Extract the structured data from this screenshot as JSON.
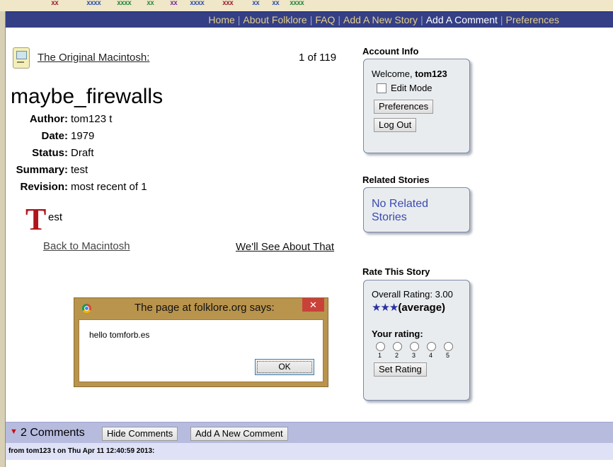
{
  "nav": {
    "items": [
      "Home",
      "About Folklore",
      "FAQ",
      "Add A New Story",
      "Add A Comment",
      "Preferences"
    ],
    "current_index": 4
  },
  "story": {
    "folder_link": "The Original Macintosh:",
    "count": "1 of 119",
    "title": "maybe_firewalls",
    "meta": [
      {
        "label": "Author:",
        "value": "tom123 t"
      },
      {
        "label": "Date:",
        "value": "1979"
      },
      {
        "label": "Status:",
        "value": "Draft"
      },
      {
        "label": "Summary:",
        "value": "test"
      },
      {
        "label": "Revision:",
        "value": "most recent of 1"
      }
    ],
    "body_dropcap": "T",
    "body_rest": "est",
    "back_link": "Back to Macintosh",
    "next_link": "We'll See About That"
  },
  "account": {
    "heading": "Account Info",
    "welcome": "Welcome,",
    "user": "tom123",
    "edit_mode": "Edit Mode",
    "preferences_btn": "Preferences",
    "logout_btn": "Log Out"
  },
  "related": {
    "heading": "Related Stories",
    "text": "No Related Stories"
  },
  "rating": {
    "heading": "Rate This Story",
    "overall": "Overall Rating: 3.00",
    "stars": "★★★",
    "star_count": 3,
    "average_label": "(average)",
    "your_rating": "Your rating:",
    "options": [
      "1",
      "2",
      "3",
      "4",
      "5"
    ],
    "set_btn": "Set Rating"
  },
  "dialog": {
    "title": "The page at folklore.org says:",
    "message": "hello tomforb.es",
    "ok": "OK",
    "close": "✕"
  },
  "comments": {
    "count": "2 Comments",
    "hide_btn": "Hide Comments",
    "add_btn": "Add A New Comment",
    "first": "from tom123 t on Thu Apr 11 12:40:59 2013:"
  },
  "colors": {
    "navbar": "#343f86",
    "nav_link": "#e5cf86",
    "dropcap": "#b2141b",
    "related_link": "#3a4bb0",
    "stars": "#2a2fa0"
  }
}
